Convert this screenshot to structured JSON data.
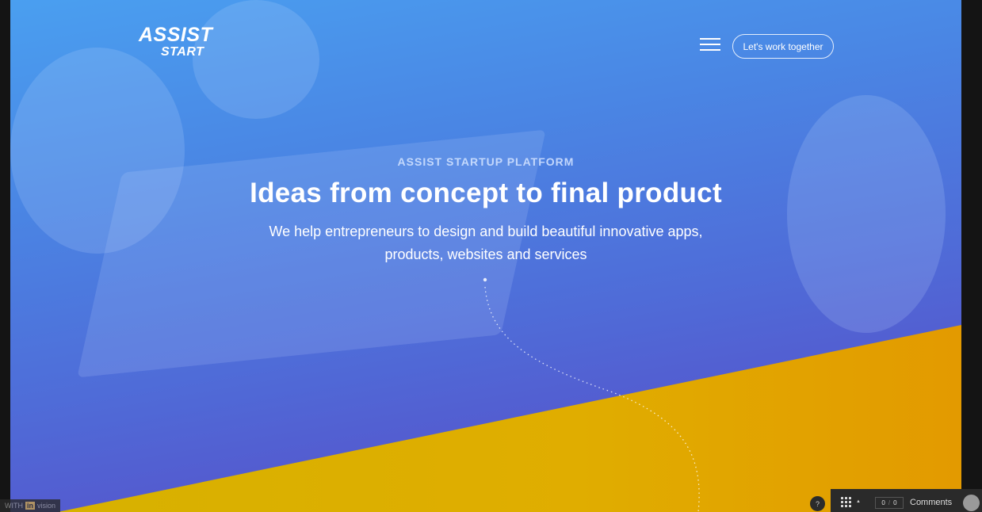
{
  "header": {
    "logo_line1": "ASSIST",
    "logo_line2": "START",
    "cta_label": "Let's work together",
    "menu_icon": "hamburger-icon"
  },
  "hero": {
    "kicker": "ASSIST STARTUP PLATFORM",
    "headline": "Ideas from concept to final product",
    "subtitle": "We help entrepreneurs to design and build beautiful innovative apps, products, websites and services"
  },
  "invision_bar": {
    "watermark_prefix": "WITH",
    "watermark_brand": "in",
    "watermark_suffix": "vision",
    "help_label": "?",
    "grid_icon": "grid-icon",
    "counter_current": "0",
    "counter_total": "0",
    "comments_label": "Comments"
  },
  "colors": {
    "hero_blue": "#4a86e4",
    "hero_purple": "#5a45c4",
    "accent_yellow": "#e0ad00",
    "text_white": "#ffffff"
  }
}
